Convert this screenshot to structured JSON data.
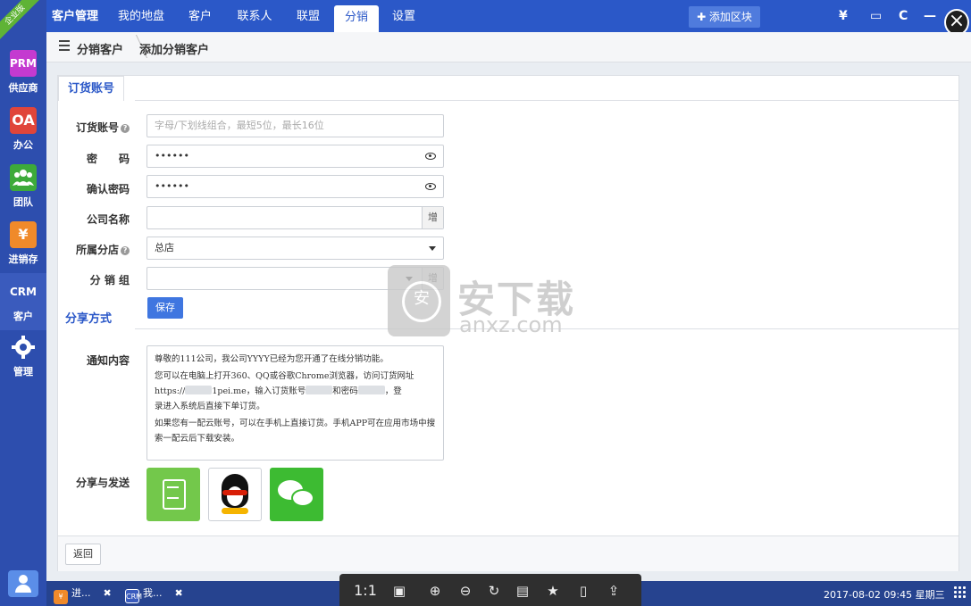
{
  "sidebar": {
    "ribbon": "企业版",
    "items": [
      {
        "icon": "PRM",
        "label": "供应商",
        "color": "#c43ad0"
      },
      {
        "icon": "OA",
        "label": "办公",
        "color": "#e0453a"
      },
      {
        "icon": "team",
        "label": "团队",
        "color": "#3daa3a"
      },
      {
        "icon": "¥",
        "label": "进销存",
        "color": "#f08a2a"
      },
      {
        "icon": "CRM",
        "label": "客户",
        "color": "#3a5bbd"
      },
      {
        "icon": "gear",
        "label": "管理",
        "color": "#2d4eae"
      }
    ]
  },
  "topnav": {
    "tabs": [
      "客户管理",
      "我的地盘",
      "客户",
      "联系人",
      "联盟",
      "分销",
      "设置"
    ],
    "active_tab": "分销",
    "add_block": "✚ 添加区块",
    "icons": [
      "¥",
      "▭",
      "C",
      "—"
    ]
  },
  "breadcrumb": {
    "first": "分销客户",
    "second": "添加分销客户"
  },
  "form": {
    "section_account": "订货账号",
    "fields": {
      "account_label": "订货账号",
      "account_placeholder": "字母/下划线组合，最短5位，最长16位",
      "password_label": "密　　码",
      "password_value": "••••••",
      "confirm_label": "确认密码",
      "confirm_value": "••••••",
      "company_label": "公司名称",
      "company_addon": "增",
      "branch_label": "所属分店",
      "branch_value": "总店",
      "group_label": "分 销 组",
      "group_addon": "增"
    },
    "save_label": "保存"
  },
  "share": {
    "section_title": "分享方式",
    "notice_label": "通知内容",
    "notice_p1": "尊敬的111公司，我公司YYYY已经为您开通了在线分销功能。",
    "notice_p2a": "您可以在电脑上打开360、QQ或谷歌Chrome浏览器，访问订货网址",
    "notice_p2b_pre": "https://",
    "notice_p2b_mid": "1pei.me，输入订货账号",
    "notice_p2b_mid2": "和密码",
    "notice_p2b_post": "，登",
    "notice_p2c": "录进入系统后直接下单订货。",
    "notice_p3": "如果您有一配云账号，可以在手机上直接订货。手机APP可在应用市场中搜索一配云后下载安装。",
    "send_label": "分享与发送"
  },
  "back_label": "返回",
  "watermark": {
    "main": "安下载",
    "sub": "anxz.com"
  },
  "taskbar": {
    "tasks": [
      {
        "badge": "¥",
        "label": "进...",
        "color": "#f08a2a"
      },
      {
        "badge": "CRM",
        "label": "我...",
        "color": "#3a5bbd"
      }
    ],
    "viewer_ratio": "1:1",
    "clock": "2017-08-02 09:45 星期三"
  }
}
